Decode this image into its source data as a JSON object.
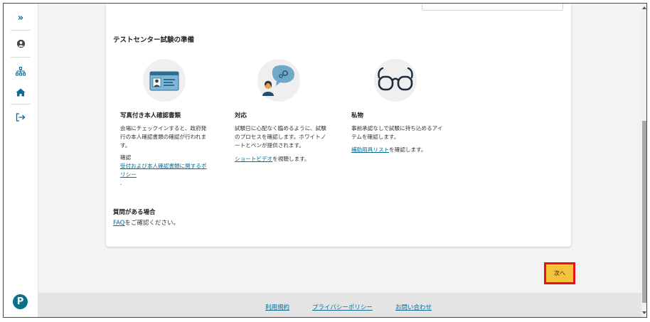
{
  "sidebar": {
    "expand_glyph": "»",
    "icons": [
      "expand-icon",
      "user-icon",
      "sitemap-icon",
      "home-icon",
      "sign-out-icon"
    ],
    "logo_letter": "P"
  },
  "section": {
    "title": "テストセンター試験の準備"
  },
  "columns": [
    {
      "icon": "id-card-icon",
      "title": "写真付き本人確認書類",
      "body": "会場にチェックインすると、政府発行の本人確認書類の確認が行われます。",
      "confirm_label": "確認",
      "link": "受付および本人確認書類に関するポリシー",
      "trailing": "."
    },
    {
      "icon": "chat-person-icon",
      "title": "対応",
      "body": "試験日に心配なく臨めるように、試験のプロセスを確認します。ホワイトノートとペンが提供されます。",
      "link": "ショートビデオ",
      "link_suffix": "を視聴します。"
    },
    {
      "icon": "glasses-icon",
      "title": "私物",
      "body": "事前承認なしで試験に持ち込めるアイテムを確認します。",
      "link": "補助用具リスト",
      "link_suffix": "を確認します。"
    }
  ],
  "questions": {
    "title": "質問がある場合",
    "link": "FAQ",
    "suffix": "をご確認ください。"
  },
  "next_button": {
    "label": "次へ"
  },
  "footer": {
    "terms": "利用規約",
    "privacy": "プライバシーポリシー",
    "contact": "お問い合わせ"
  },
  "colors": {
    "accent": "#0b6b94",
    "next_button": "#f6c23a",
    "highlight": "#e5131d",
    "logo": "#0d6f89"
  }
}
